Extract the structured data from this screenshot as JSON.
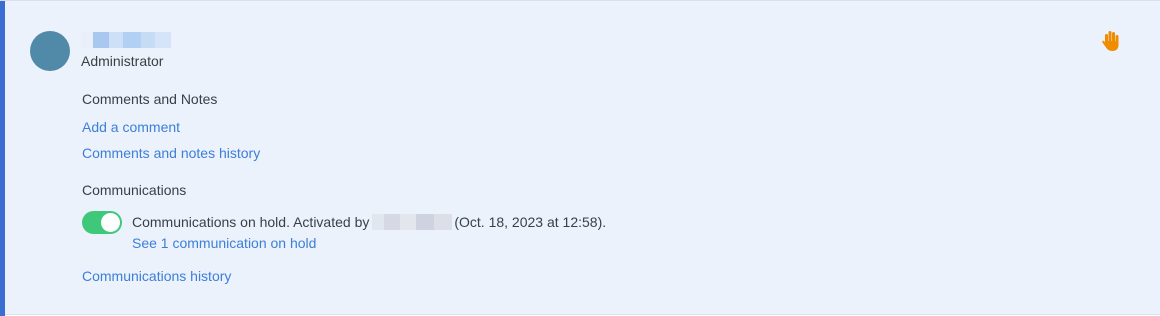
{
  "colors": {
    "accent": "#3a6fd1",
    "avatar": "#5189a8",
    "toggle_on": "#3ec97a",
    "hold_icon": "#f08c00",
    "link": "#3d7ed8"
  },
  "user": {
    "role": "Administrator"
  },
  "header": {
    "hold_icon": "raised-hand-icon"
  },
  "comments": {
    "title": "Comments and Notes",
    "add_link": "Add a comment",
    "history_link": "Comments and notes history"
  },
  "communications": {
    "title": "Communications",
    "toggle_on": true,
    "status_prefix": "Communications on hold. Activated by",
    "status_suffix": "(Oct. 18, 2023 at 12:58).",
    "see_link": "See 1 communication on hold",
    "history_link": "Communications history"
  }
}
